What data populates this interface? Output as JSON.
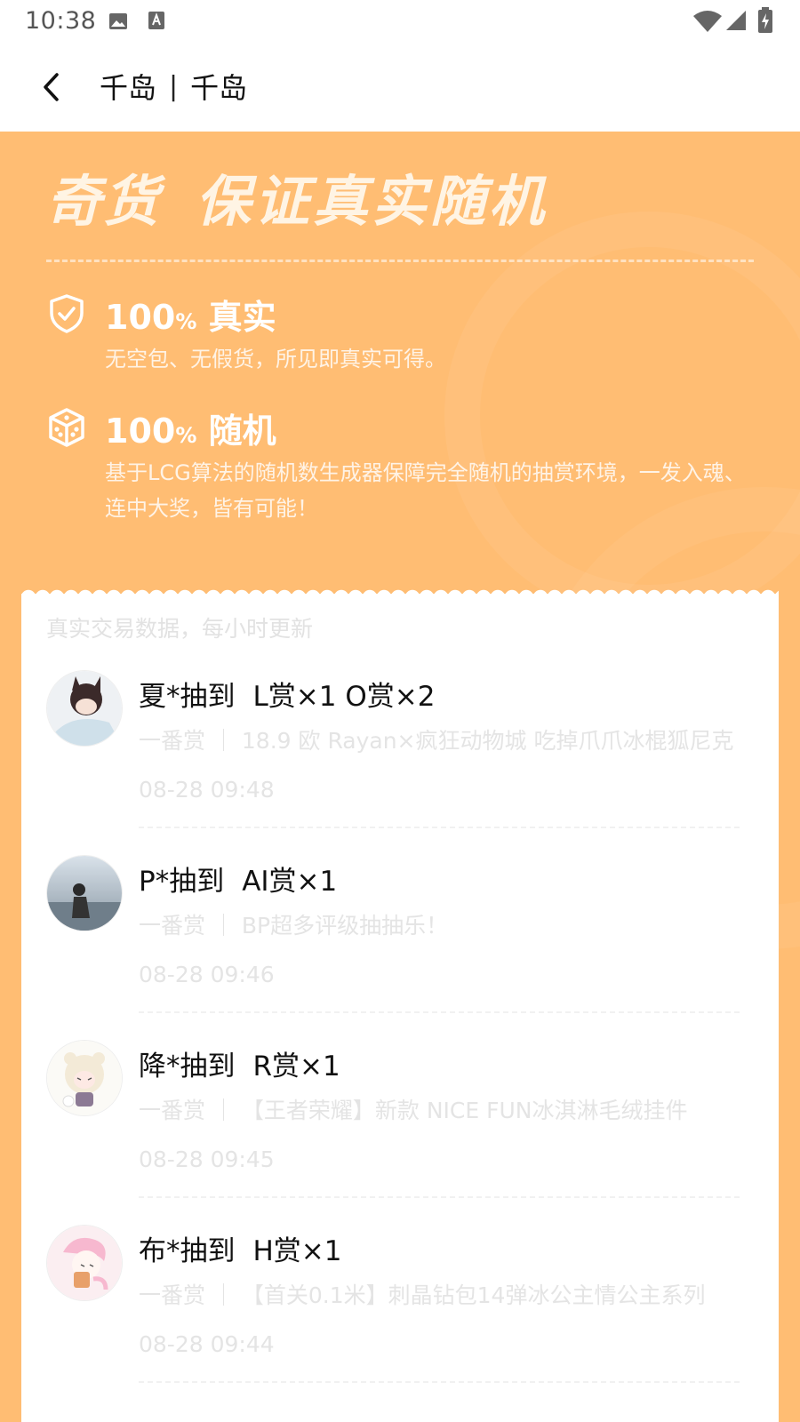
{
  "status_bar": {
    "time": "10:38"
  },
  "app_bar": {
    "title_left": "千岛",
    "separator": "|",
    "title_right": "千岛"
  },
  "banner": {
    "brand": "奇货",
    "slogan": "保证真实随机",
    "features": [
      {
        "icon": "shield-check-icon",
        "number": "100",
        "pct": "%",
        "label": "真实",
        "description": "无空包、无假货，所见即真实可得。"
      },
      {
        "icon": "dice-icon",
        "number": "100",
        "pct": "%",
        "label": "随机",
        "description": "基于LCG算法的随机数生成器保障完全随机的抽赏环境，一发入魂、连中大奖，皆有可能！"
      }
    ]
  },
  "records": {
    "caption": "真实交易数据，每小时更新",
    "items": [
      {
        "user_action": "夏*抽到",
        "prize": "L赏×1  O赏×2",
        "subtitle": "一番赏 ｜ 18.9 欧 Rayan×疯狂动物城 吃掉爪爪冰棍狐尼克",
        "time": "08-28 09:48"
      },
      {
        "user_action": "P*抽到",
        "prize": "AI赏×1",
        "subtitle": "一番赏 ｜ BP超多评级抽抽乐！",
        "time": "08-28 09:46"
      },
      {
        "user_action": "降*抽到",
        "prize": "R赏×1",
        "subtitle": "一番赏 ｜ 【王者荣耀】新款 NICE FUN冰淇淋毛绒挂件",
        "time": "08-28 09:45"
      },
      {
        "user_action": "布*抽到",
        "prize": "H赏×1",
        "subtitle": "一番赏 ｜ 【首关0.1米】刺晶钻包14弹冰公主情公主系列",
        "time": "08-28 09:44"
      }
    ]
  },
  "colors": {
    "banner_bg": "#ffbd73",
    "card_bg": "#ffffff",
    "muted_text": "#e4e4e4"
  }
}
